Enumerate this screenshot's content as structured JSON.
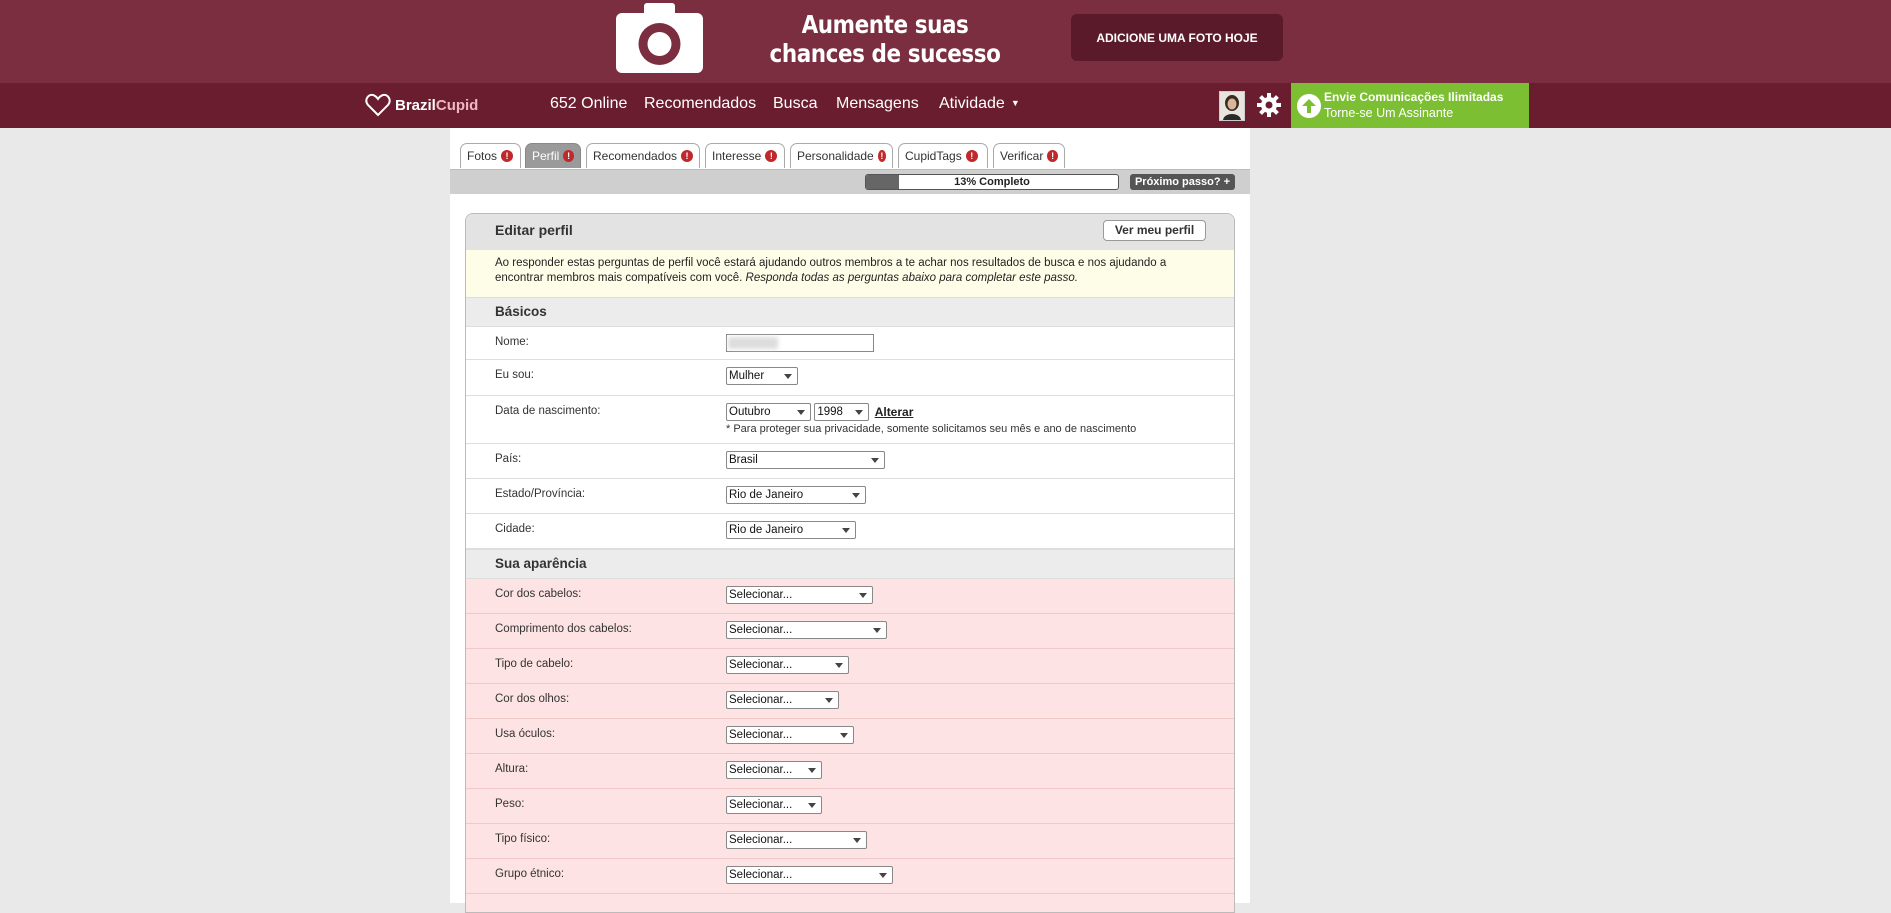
{
  "promo": {
    "headline": "Aumente suas chances de sucesso",
    "cta_label": "ADICIONE UMA FOTO HOJE",
    "icon": "camera-icon"
  },
  "nav": {
    "logo_brand": "Brazil",
    "logo_accent": "Cupid",
    "online": "652 Online",
    "recommended": "Recomendados",
    "search": "Busca",
    "messages": "Mensagens",
    "activity": "Atividade",
    "upgrade_line1": "Envie Comunicações Ilimitadas",
    "upgrade_line2": "Torne-se Um Assinante"
  },
  "tabs": [
    {
      "label": "Fotos"
    },
    {
      "label": "Perfil"
    },
    {
      "label": "Recomendados"
    },
    {
      "label": "Interesse"
    },
    {
      "label": "Personalidade"
    },
    {
      "label": "CupidTags"
    },
    {
      "label": "Verificar"
    }
  ],
  "progress": {
    "label": "13% Completo",
    "percent": 13,
    "next_label": "Próximo passo? +"
  },
  "panel": {
    "title": "Editar perfil",
    "view_profile": "Ver meu perfil",
    "intro_text": "Ao responder estas perguntas de perfil você estará ajudando outros membros a te achar nos resultados de busca e nos ajudando a encontrar membros mais compatíveis com você.",
    "intro_italic": "Responda todas as perguntas abaixo para completar este passo."
  },
  "basics": {
    "title": "Básicos",
    "name_label": "Nome:",
    "gender_label": "Eu sou:",
    "gender_value": "Mulher",
    "birth_label": "Data de nascimento:",
    "birth_month": "Outubro",
    "birth_year": "1998",
    "birth_change": "Alterar",
    "birth_note": "* Para proteger sua privacidade, somente solicitamos seu mês e ano de nascimento",
    "country_label": "País:",
    "country_value": "Brasil",
    "state_label": "Estado/Província:",
    "state_value": "Rio de Janeiro",
    "city_label": "Cidade:",
    "city_value": "Rio de Janeiro"
  },
  "appearance": {
    "title": "Sua aparência",
    "fields": [
      {
        "label": "Cor dos cabelos:",
        "value": "Selecionar..."
      },
      {
        "label": "Comprimento dos cabelos:",
        "value": "Selecionar..."
      },
      {
        "label": "Tipo de cabelo:",
        "value": "Selecionar..."
      },
      {
        "label": "Cor dos olhos:",
        "value": "Selecionar..."
      },
      {
        "label": "Usa óculos:",
        "value": "Selecionar..."
      },
      {
        "label": "Altura:",
        "value": "Selecionar..."
      },
      {
        "label": "Peso:",
        "value": "Selecionar..."
      },
      {
        "label": "Tipo físico:",
        "value": "Selecionar..."
      },
      {
        "label": "Grupo étnico:",
        "value": "Selecionar..."
      }
    ]
  }
}
